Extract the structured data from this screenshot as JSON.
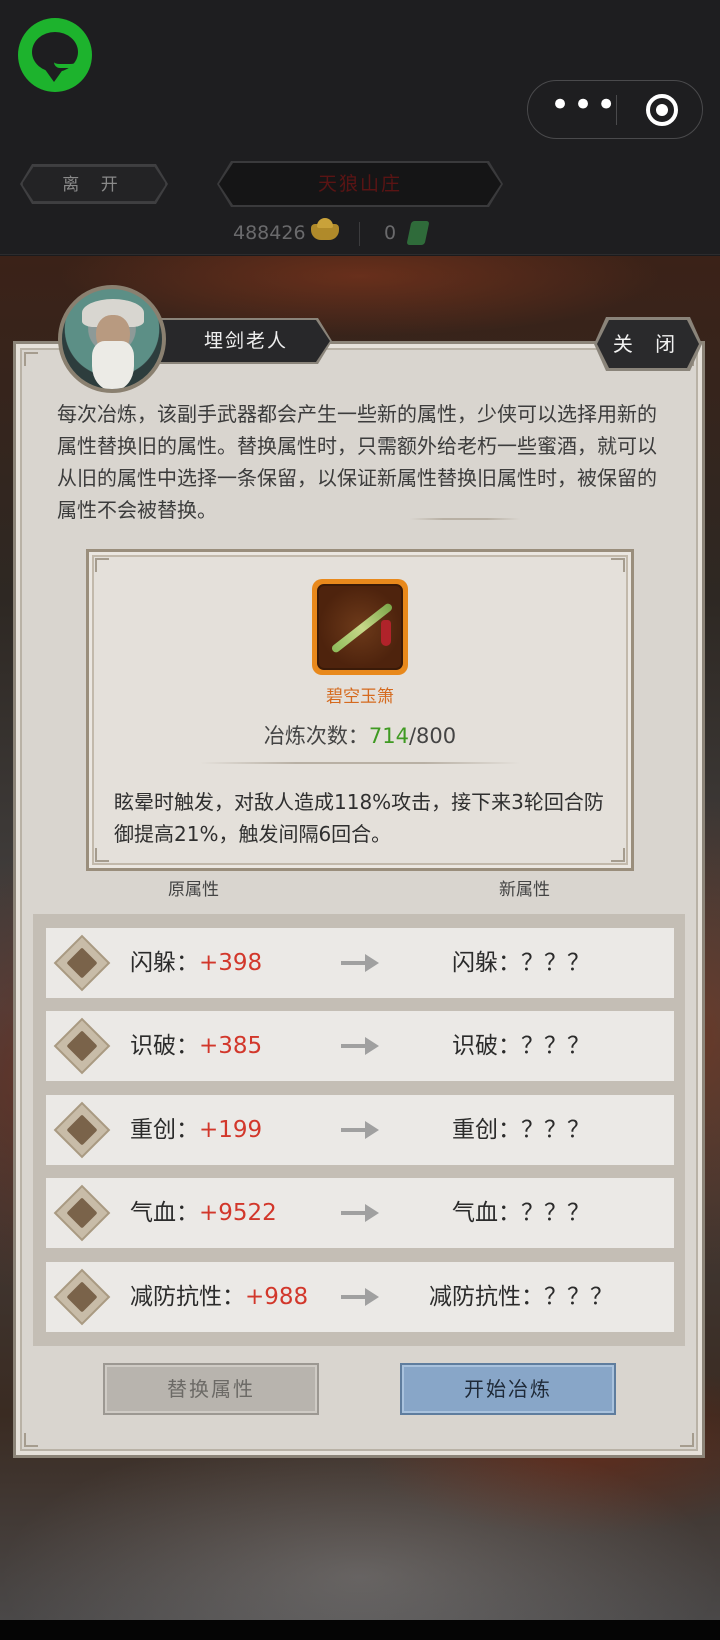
{
  "header": {
    "leave_label": "离 开",
    "location": "天狼山庄",
    "gold_amount": "488426",
    "jade_amount": "0",
    "more_icon": "more-dots-icon",
    "close_icon": "close-target-icon"
  },
  "dialog": {
    "npc_name": "埋剑老人",
    "close_label": "关 闭",
    "intro": "每次冶炼，该副手武器都会产生一些新的属性，少侠可以选择用新的属性替换旧的属性。替换属性时，只需额外给老朽一些蜜酒，就可以从旧的属性中选择一条保留，以保证新属性替换旧属性时，被保留的属性不会被替换。",
    "item": {
      "name": "碧空玉箫",
      "count_label": "冶炼次数：",
      "count_current": "714",
      "count_total": "/800",
      "description": "眩晕时触发，对敌人造成118%攻击，接下来3轮回合防御提高21%，触发间隔6回合。"
    },
    "col_old": "原属性",
    "col_new": "新属性",
    "attributes": [
      {
        "name": "闪躲：",
        "value": "+398",
        "new": "闪躲：？？？"
      },
      {
        "name": "识破：",
        "value": "+385",
        "new": "识破：？？？"
      },
      {
        "name": "重创：",
        "value": "+199",
        "new": "重创：？？？"
      },
      {
        "name": "气血：",
        "value": "+9522",
        "new": "气血：？？？"
      },
      {
        "name": "减防抗性：",
        "value": "+988",
        "new": "减防抗性：？？？"
      }
    ],
    "replace_label": "替换属性",
    "start_label": "开始冶炼"
  },
  "colors": {
    "accent_green": "#1db32d",
    "value_red": "#d2372b",
    "item_orange": "#d56a1e",
    "count_green": "#3f9a22",
    "start_button": "#88a6c8"
  }
}
